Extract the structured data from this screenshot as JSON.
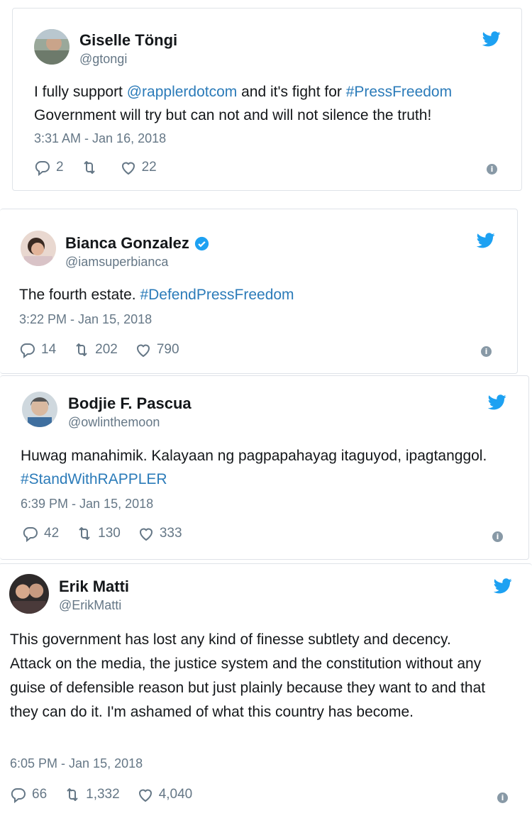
{
  "colors": {
    "link": "#2b7bb9",
    "muted": "#657786",
    "twitter_blue": "#1da1f2",
    "text": "#14171a"
  },
  "tweets": [
    {
      "name": "Giselle Töngi",
      "handle": "@gtongi",
      "verified": false,
      "avatar_icon": "avatar-photo-icon",
      "text_parts": [
        {
          "t": "I fully support ",
          "link": false
        },
        {
          "t": "@rapplerdotcom",
          "link": true
        },
        {
          "t": " and it's fight for ",
          "link": false
        },
        {
          "t": "#PressFreedom",
          "link": true
        },
        {
          "t": " Government will try but can not and will not silence the truth!",
          "link": false
        }
      ],
      "time": "3:31 AM - Jan 16, 2018",
      "replies": "2",
      "retweets": "",
      "likes": "22"
    },
    {
      "name": "Bianca Gonzalez",
      "handle": "@iamsuperbianca",
      "verified": true,
      "avatar_icon": "avatar-photo-icon",
      "text_parts": [
        {
          "t": "The fourth estate. ",
          "link": false
        },
        {
          "t": "#DefendPressFreedom",
          "link": true
        }
      ],
      "time": "3:22 PM - Jan 15, 2018",
      "replies": "14",
      "retweets": "202",
      "likes": "790"
    },
    {
      "name": "Bodjie F. Pascua",
      "handle": "@owlinthemoon",
      "verified": false,
      "avatar_icon": "avatar-photo-icon",
      "text_parts": [
        {
          "t": "Huwag manahimik. Kalayaan ng pagpapahayag itaguyod, ipagtanggol.  ",
          "link": false
        },
        {
          "t": "#StandWithRAPPLER",
          "link": true
        }
      ],
      "time": "6:39 PM - Jan 15, 2018",
      "replies": "42",
      "retweets": "130",
      "likes": "333"
    },
    {
      "name": "Erik Matti",
      "handle": "@ErikMatti",
      "verified": false,
      "avatar_icon": "avatar-photo-icon",
      "text_parts": [
        {
          "t": "This government has lost any kind of finesse subtlety and decency. Attack on the media, the justice system and the constitution without any guise of defensible reason but just plainly because they want to and that they can do it. I'm ashamed of what this country has become.",
          "link": false
        }
      ],
      "time": "6:05 PM - Jan 15, 2018",
      "replies": "66",
      "retweets": "1,332",
      "likes": "4,040"
    }
  ]
}
